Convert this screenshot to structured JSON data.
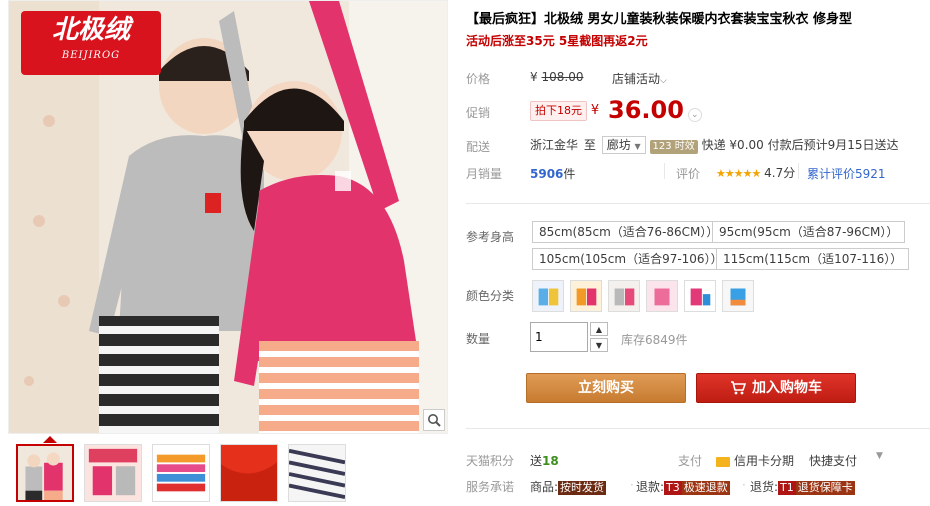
{
  "brand": {
    "logo_cn": "北极绒",
    "logo_en": "BEIJIROG"
  },
  "product": {
    "title": "【最后疯狂】北极绒 男女儿童装秋装保暖内衣套装宝宝秋衣 修身型",
    "subtitle": "活动后涨至35元 5星截图再返2元"
  },
  "price": {
    "label": "价格",
    "yen": "¥",
    "original": "108.00",
    "store_activity": "店铺活动"
  },
  "promo": {
    "label": "促销",
    "tag": "拍下18元",
    "yen": "¥",
    "current": "36.00"
  },
  "delivery": {
    "label": "配送",
    "from": "浙江金华",
    "to_word": "至",
    "to": "廊坊",
    "tag": "123 时效",
    "text": "快递 ¥0.00 付款后预计9月15日送达"
  },
  "sales": {
    "label": "月销量",
    "count": "5906",
    "unit": "件",
    "rating_label": "评价",
    "stars": "★★★★★",
    "score": "4.7分",
    "reviews": "累计评价5921",
    "rating_value": 4.7
  },
  "size": {
    "label": "参考身高",
    "options": [
      "85cm(85cm（适合76-86CM））",
      "95cm(95cm（适合87-96CM））",
      "105cm(105cm（适合97-106））",
      "115cm(115cm（适107-116））"
    ]
  },
  "color": {
    "label": "颜色分类",
    "swatches": [
      "gray-top",
      "pink-top",
      "gray-pink",
      "pink-heart",
      "rose-blue",
      "blue-white"
    ]
  },
  "quantity": {
    "label": "数量",
    "value": "1",
    "stock": "库存6849件"
  },
  "actions": {
    "buy": "立刻购买",
    "cart": "加入购物车"
  },
  "points": {
    "label": "天猫积分",
    "prefix": "送",
    "value": "18",
    "pay_label": "支付",
    "credit": "信用卡分期",
    "quick": "快捷支付"
  },
  "service": {
    "label": "服务承诺",
    "item1_prefix": "商品:",
    "item1_tag": "按时发货",
    "item2_prefix": "退款:",
    "item2_code": "T3",
    "item2_tag": "极速退款",
    "item3_prefix": "退货:",
    "item3_code": "T1",
    "item3_tag": "退货保障卡"
  },
  "colors": {
    "accent": "#c40000",
    "buy_button": "#d38a3f",
    "cart_button": "#d4271d",
    "logo_bg": "#d8131e",
    "link": "#3366cc"
  }
}
